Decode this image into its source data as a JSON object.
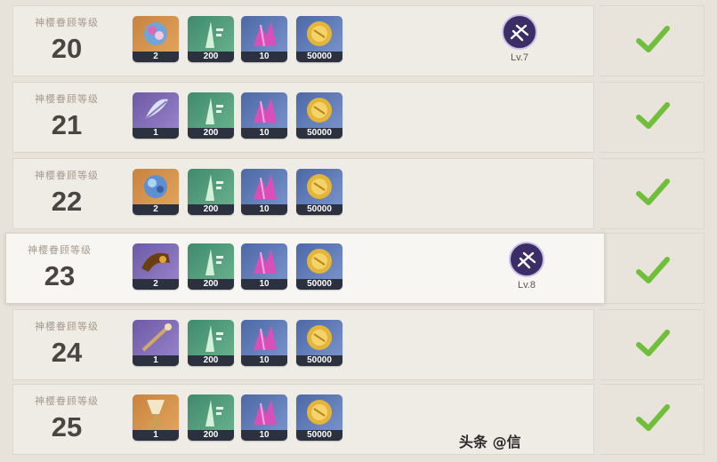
{
  "level_label": "神樱眷顾等级",
  "rows": [
    {
      "level": "20",
      "items": [
        {
          "name": "orange-gem-icon",
          "qty": "2",
          "bg": "orange"
        },
        {
          "name": "stem-bundle-icon",
          "qty": "200",
          "bg": "green"
        },
        {
          "name": "crystal-icon",
          "qty": "10",
          "bg": "blue"
        },
        {
          "name": "mora-coin-icon",
          "qty": "50000",
          "bg": "blue"
        }
      ],
      "talent_level": "Lv.7",
      "completed": true
    },
    {
      "level": "21",
      "items": [
        {
          "name": "feather-icon",
          "qty": "1",
          "bg": "purple"
        },
        {
          "name": "stem-bundle-icon",
          "qty": "200",
          "bg": "green"
        },
        {
          "name": "crystal-icon",
          "qty": "10",
          "bg": "blue"
        },
        {
          "name": "mora-coin-icon",
          "qty": "50000",
          "bg": "blue"
        }
      ],
      "talent_level": "",
      "completed": true
    },
    {
      "level": "22",
      "items": [
        {
          "name": "blue-gem-icon",
          "qty": "2",
          "bg": "orange"
        },
        {
          "name": "stem-bundle-icon",
          "qty": "200",
          "bg": "green"
        },
        {
          "name": "crystal-icon",
          "qty": "10",
          "bg": "blue"
        },
        {
          "name": "mora-coin-icon",
          "qty": "50000",
          "bg": "blue"
        }
      ],
      "talent_level": "",
      "completed": true
    },
    {
      "level": "23",
      "items": [
        {
          "name": "horn-icon",
          "qty": "2",
          "bg": "purple"
        },
        {
          "name": "stem-bundle-icon",
          "qty": "200",
          "bg": "green"
        },
        {
          "name": "crystal-icon",
          "qty": "10",
          "bg": "blue"
        },
        {
          "name": "mora-coin-icon",
          "qty": "50000",
          "bg": "blue"
        }
      ],
      "talent_level": "Lv.8",
      "completed": true
    },
    {
      "level": "24",
      "items": [
        {
          "name": "staff-icon",
          "qty": "1",
          "bg": "purple"
        },
        {
          "name": "stem-bundle-icon",
          "qty": "200",
          "bg": "green"
        },
        {
          "name": "crystal-icon",
          "qty": "10",
          "bg": "blue"
        },
        {
          "name": "mora-coin-icon",
          "qty": "50000",
          "bg": "blue"
        }
      ],
      "talent_level": "",
      "completed": true
    },
    {
      "level": "25",
      "items": [
        {
          "name": "chalice-icon",
          "qty": "1",
          "bg": "orange"
        },
        {
          "name": "stem-bundle-icon",
          "qty": "200",
          "bg": "green"
        },
        {
          "name": "crystal-icon",
          "qty": "10",
          "bg": "blue"
        },
        {
          "name": "mora-coin-icon",
          "qty": "50000",
          "bg": "blue"
        }
      ],
      "talent_level": "",
      "completed": true
    }
  ],
  "colors": {
    "check": "#6fbf3b",
    "badge": "#3c2d67",
    "number": "#4a4542"
  },
  "watermark": "头条 @信"
}
